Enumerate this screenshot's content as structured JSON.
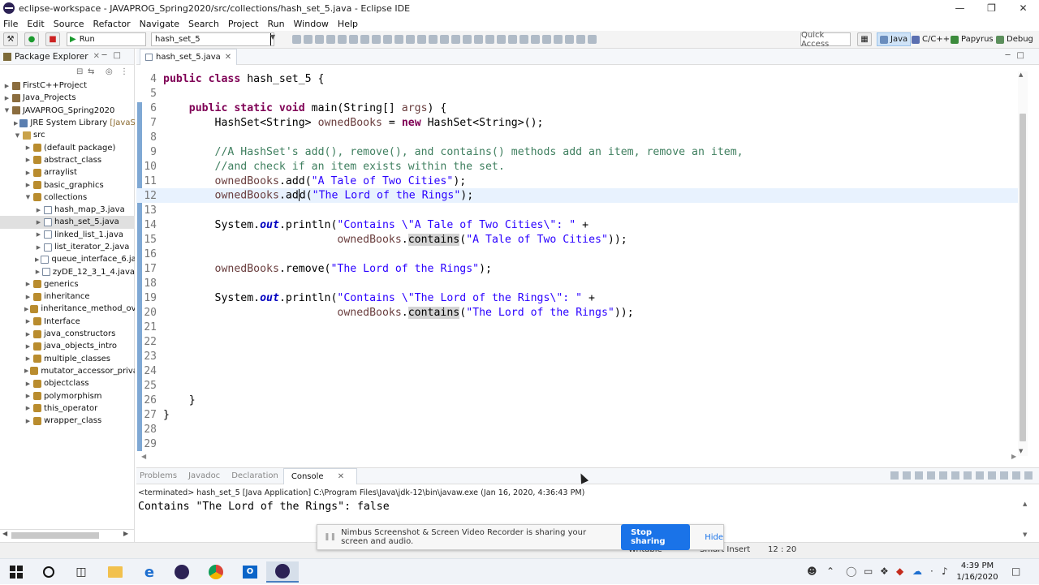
{
  "window": {
    "title": "eclipse-workspace - JAVAPROG_Spring2020/src/collections/hash_set_5.java - Eclipse IDE"
  },
  "menu": [
    "File",
    "Edit",
    "Source",
    "Refactor",
    "Navigate",
    "Search",
    "Project",
    "Run",
    "Window",
    "Help"
  ],
  "toolbar": {
    "run_label": "Run",
    "config_label": "hash_set_5",
    "quick_access": "Quick Access",
    "perspectives": [
      "Java",
      "C/C++",
      "Papyrus",
      "Debug"
    ]
  },
  "package_explorer": {
    "title": "Package Explorer",
    "items": [
      {
        "label": "FirstC++Project",
        "deco": ""
      },
      {
        "label": "Java_Projects",
        "deco": ""
      },
      {
        "label": "JAVAPROG_Spring2020",
        "deco": ""
      },
      {
        "label": "JRE System Library",
        "deco": "[JavaSE"
      },
      {
        "label": "src",
        "deco": ""
      },
      {
        "label": "(default package)",
        "deco": ""
      },
      {
        "label": "abstract_class",
        "deco": ""
      },
      {
        "label": "arraylist",
        "deco": ""
      },
      {
        "label": "basic_graphics",
        "deco": ""
      },
      {
        "label": "collections",
        "deco": ""
      },
      {
        "label": "hash_map_3.java",
        "deco": ""
      },
      {
        "label": "hash_set_5.java",
        "deco": ""
      },
      {
        "label": "linked_list_1.java",
        "deco": ""
      },
      {
        "label": "list_iterator_2.java",
        "deco": ""
      },
      {
        "label": "queue_interface_6.ja",
        "deco": ""
      },
      {
        "label": "zyDE_12_3_1_4.java",
        "deco": ""
      },
      {
        "label": "generics",
        "deco": ""
      },
      {
        "label": "inheritance",
        "deco": ""
      },
      {
        "label": "inheritance_method_ove",
        "deco": ""
      },
      {
        "label": "Interface",
        "deco": ""
      },
      {
        "label": "java_constructors",
        "deco": ""
      },
      {
        "label": "java_objects_intro",
        "deco": ""
      },
      {
        "label": "multiple_classes",
        "deco": ""
      },
      {
        "label": "mutator_accessor_priva",
        "deco": ""
      },
      {
        "label": "objectclass",
        "deco": ""
      },
      {
        "label": "polymorphism",
        "deco": ""
      },
      {
        "label": "this_operator",
        "deco": ""
      },
      {
        "label": "wrapper_class",
        "deco": ""
      }
    ]
  },
  "editor": {
    "tab": "hash_set_5.java",
    "line_numbers": [
      "4",
      "5",
      "6",
      "7",
      "8",
      "9",
      "10",
      "11",
      "12",
      "13",
      "14",
      "15",
      "16",
      "17",
      "18",
      "19",
      "20",
      "21",
      "22",
      "23",
      "24",
      "25",
      "26",
      "27",
      "28",
      "29"
    ],
    "code": {
      "l4_kw": "public class",
      "l4_rest": " hash_set_5 {",
      "l6_kw": "public static void",
      "l6_rest": " main(String[] ",
      "l6_var": "args",
      "l6_end": ") {",
      "l7_a": "HashSet<String> ",
      "l7_var": "ownedBooks",
      "l7_b": " = ",
      "l7_kw": "new",
      "l7_c": " HashSet<String>();",
      "l9": "//A HashSet's add(), remove(), and contains() methods add an item, remove an item,",
      "l10": "//and check if an item exists within the set.",
      "l11_var": "ownedBooks",
      "l11_m": ".add(",
      "l11_str": "\"A Tale of Two Cities\"",
      "l11_end": ");",
      "l12_var": "ownedBooks",
      "l12_m1": ".ad",
      "l12_m2": "d(",
      "l12_str": "\"The Lord of the Rings\"",
      "l12_end": ");",
      "l14_a": "System.",
      "l14_fld": "out",
      "l14_b": ".println(",
      "l14_str": "\"Contains \\\"A Tale of Two Cities\\\": \"",
      "l14_end": " +",
      "l15_var": "ownedBooks",
      "l15_dot": ".",
      "l15_m": "contains",
      "l15_p": "(",
      "l15_str": "\"A Tale of Two Cities\"",
      "l15_end": "));",
      "l17_var": "ownedBooks",
      "l17_m": ".remove(",
      "l17_str": "\"The Lord of the Rings\"",
      "l17_end": ");",
      "l19_a": "System.",
      "l19_fld": "out",
      "l19_b": ".println(",
      "l19_str": "\"Contains \\\"The Lord of the Rings\\\": \"",
      "l19_end": " +",
      "l20_var": "ownedBooks",
      "l20_dot": ".",
      "l20_m": "contains",
      "l20_p": "(",
      "l20_str": "\"The Lord of the Rings\"",
      "l20_end": "));",
      "l26": "}",
      "l27": "}"
    }
  },
  "console": {
    "tabs": [
      "Problems",
      "Javadoc",
      "Declaration",
      "Console"
    ],
    "terminated": "<terminated> hash_set_5 [Java Application] C:\\Program Files\\Java\\jdk-12\\bin\\javaw.exe (Jan 16, 2020, 4:36:43 PM)",
    "output": "Contains \"The Lord of the Rings\": false"
  },
  "share_bar": {
    "message": "Nimbus Screenshot & Screen Video Recorder is sharing your screen and audio.",
    "stop": "Stop sharing",
    "hide": "Hide"
  },
  "status_bar": {
    "writable": "Writable",
    "insert": "Smart Insert",
    "position": "12 : 20"
  },
  "taskbar": {
    "time": "4:39 PM",
    "date": "1/16/2020"
  },
  "colors": {
    "keyword": "#7f0055",
    "string": "#2a00ff",
    "comment": "#3f7f5f",
    "accent": "#1a73e8"
  }
}
